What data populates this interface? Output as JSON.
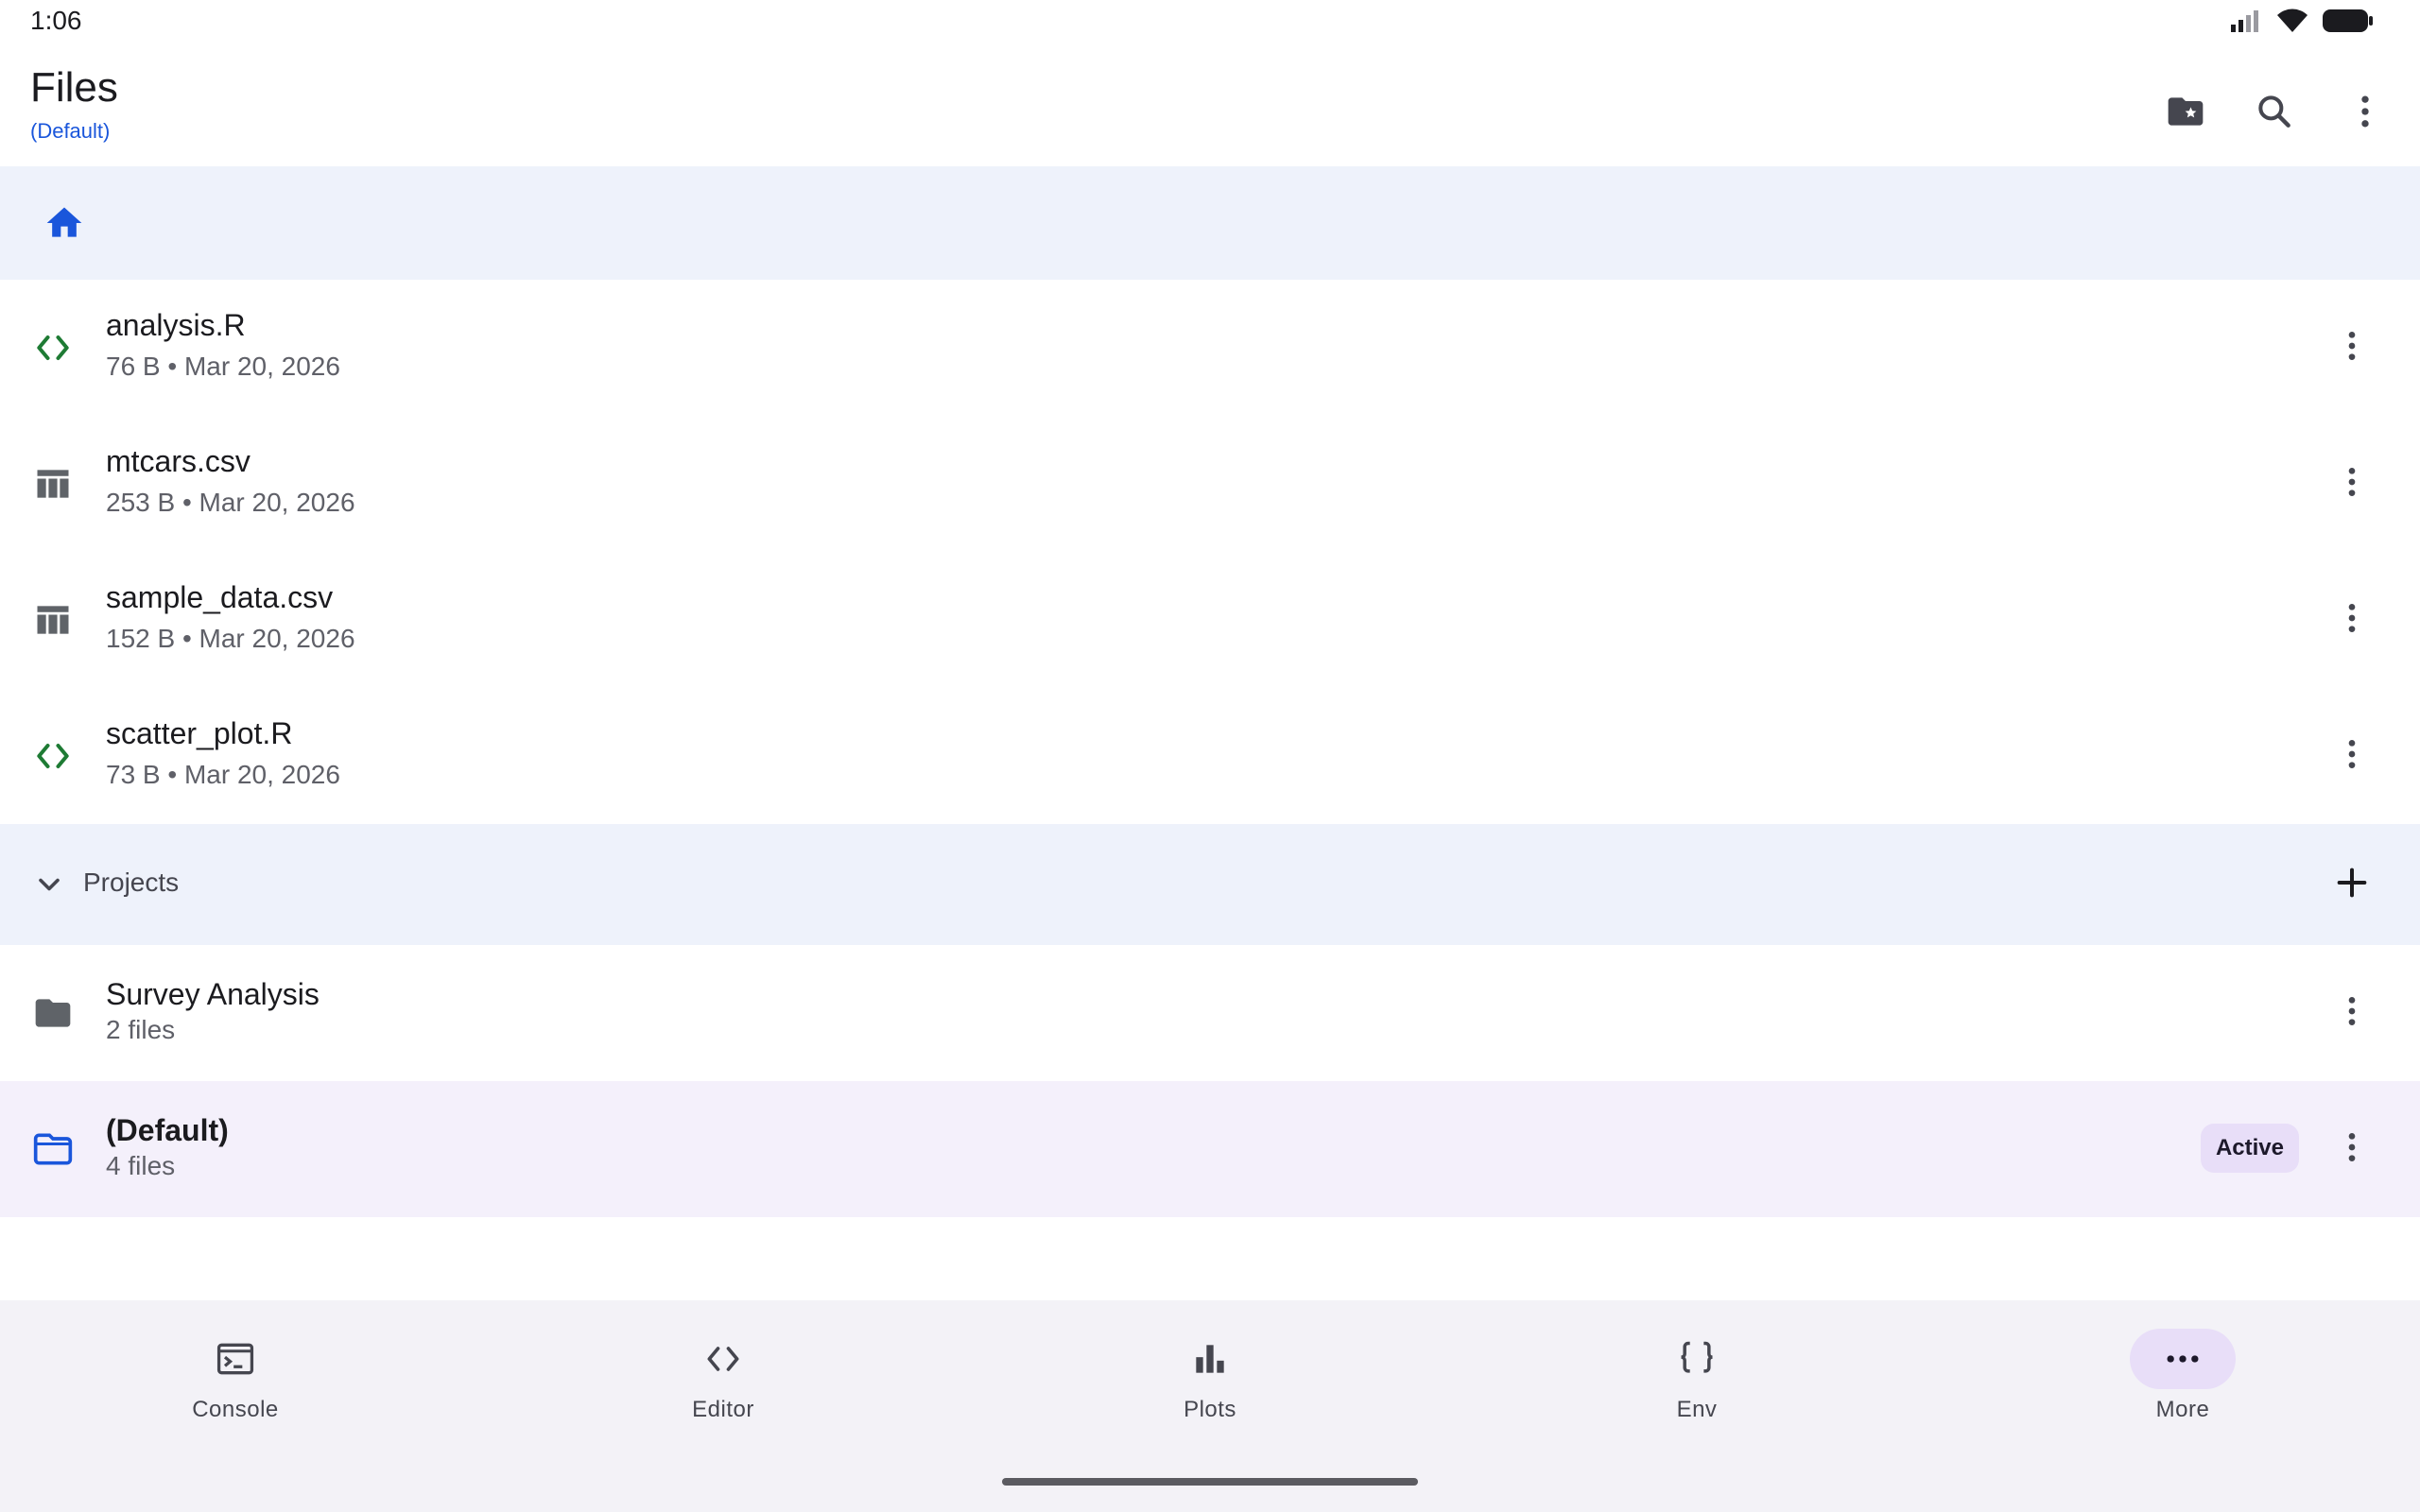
{
  "status_bar": {
    "time": "1:06"
  },
  "app_bar": {
    "title": "Files",
    "subtitle": "(Default)",
    "actions": [
      "folder-star-icon",
      "search-icon",
      "more-vert-icon"
    ]
  },
  "breadcrumb": {
    "icon": "home-icon"
  },
  "files": [
    {
      "name": "analysis.R",
      "meta": "76 B • Mar 20, 2026",
      "icon": "code-icon"
    },
    {
      "name": "mtcars.csv",
      "meta": "253 B • Mar 20, 2026",
      "icon": "table-icon"
    },
    {
      "name": "sample_data.csv",
      "meta": "152 B • Mar 20, 2026",
      "icon": "table-icon"
    },
    {
      "name": "scatter_plot.R",
      "meta": "73 B • Mar 20, 2026",
      "icon": "code-icon"
    }
  ],
  "projects_section": {
    "label": "Projects"
  },
  "projects": [
    {
      "name": "Survey Analysis",
      "meta": "2 files",
      "icon": "folder-icon"
    },
    {
      "name": "(Default)",
      "meta": "4 files",
      "icon": "folder-outline-icon",
      "badge": "Active"
    }
  ],
  "bottom_nav": {
    "items": [
      {
        "label": "Console",
        "icon": "terminal-icon"
      },
      {
        "label": "Editor",
        "icon": "code-icon"
      },
      {
        "label": "Plots",
        "icon": "bar-chart-icon"
      },
      {
        "label": "Env",
        "icon": "braces-icon"
      },
      {
        "label": "More",
        "icon": "more-horiz-icon",
        "selected": true
      }
    ]
  },
  "colors": {
    "accent": "#1a56db",
    "code_icon": "#1e7b34",
    "table_icon": "#5f6368",
    "surface_tint": "#eef2fb",
    "active_row": "#f4f0fb",
    "badge_bg": "#e8def8"
  }
}
